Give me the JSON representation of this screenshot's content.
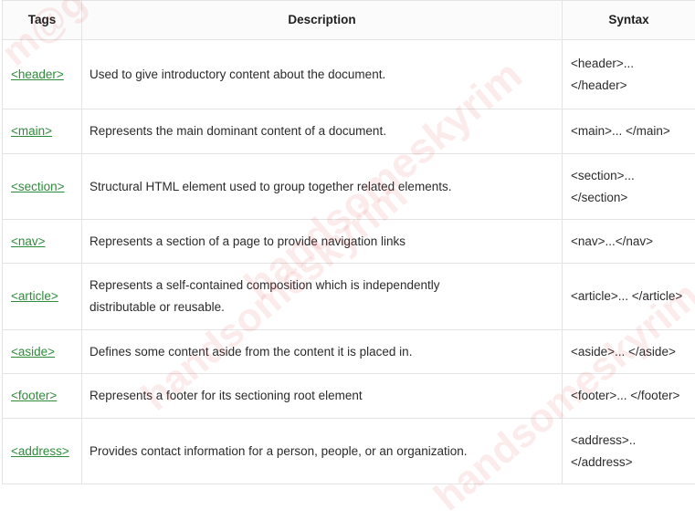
{
  "table": {
    "headers": [
      "Tags",
      "Description",
      "Syntax"
    ],
    "rows": [
      {
        "tag": "<header>",
        "description": "Used to give introductory content about the document.",
        "syntax_1": "<header>...",
        "syntax_2": "</header>"
      },
      {
        "tag": "<main>",
        "description": "Represents the main dominant content of a document.",
        "syntax_1": "<main>... </main>",
        "syntax_2": ""
      },
      {
        "tag": "<section>",
        "description": "Structural HTML element used to group together related elements.",
        "syntax_1": "<section>...",
        "syntax_2": "</section>"
      },
      {
        "tag": "<nav>",
        "description": "Represents a section of a page to provide navigation links",
        "syntax_1": "<nav>...</nav>",
        "syntax_2": ""
      },
      {
        "tag": "<article>",
        "description": "Represents a self-contained composition which is independently distributable or reusable.",
        "syntax_1": "<article>... </article>",
        "syntax_2": ""
      },
      {
        "tag": "<aside>",
        "description": "Defines some content aside from the content it is placed in.",
        "syntax_1": "<aside>... </aside>",
        "syntax_2": ""
      },
      {
        "tag": "<footer>",
        "description": "Represents a footer for its sectioning root element",
        "syntax_1": "<footer>... </footer>",
        "syntax_2": ""
      },
      {
        "tag": "<address>",
        "description": "Provides contact information for a person, people, or an organization.",
        "syntax_1": "<address>..",
        "syntax_2": "</address>"
      }
    ]
  },
  "watermark": {
    "text_1": "m@g",
    "text_2": "handsomeskyrim",
    "text_3": "handsomeskyrim",
    "text_4": "handsomeskyrim"
  },
  "colors": {
    "tag_link": "#2e8b3a",
    "border": "#e3e3e3",
    "watermark": "#e63c3c"
  }
}
